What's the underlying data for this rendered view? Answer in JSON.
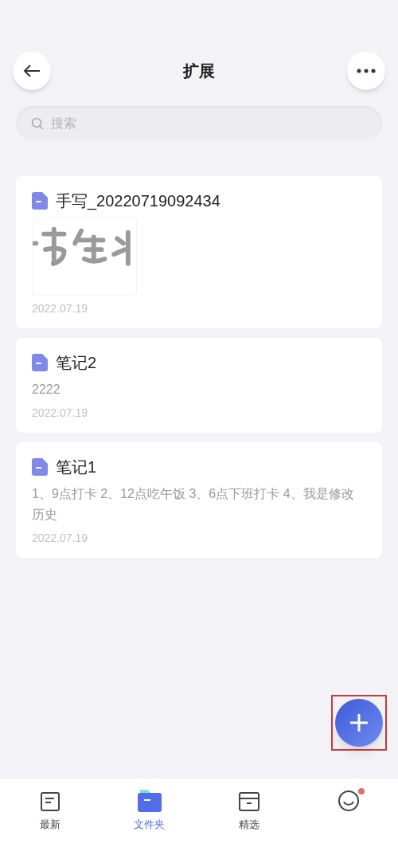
{
  "header": {
    "title": "扩展"
  },
  "search": {
    "placeholder": "搜索"
  },
  "notes": [
    {
      "kind": "handwriting",
      "title": "手写_20220719092434",
      "date": "2022.07.19"
    },
    {
      "kind": "text",
      "title": "笔记2",
      "body": "2222",
      "date": "2022.07.19"
    },
    {
      "kind": "text",
      "title": "笔记1",
      "body": "1、9点打卡 2、12点吃午饭 3、6点下班打卡 4、我是修改历史",
      "date": "2022.07.19"
    }
  ],
  "fab": {
    "highlighted": true
  },
  "tabs": [
    {
      "kind": "recent",
      "label": "最新",
      "selected": false,
      "badge": false
    },
    {
      "kind": "folder",
      "label": "文件夹",
      "selected": true,
      "badge": false
    },
    {
      "kind": "featured",
      "label": "精选",
      "selected": false,
      "badge": false
    },
    {
      "kind": "profile",
      "selected": false,
      "badge": true
    }
  ]
}
